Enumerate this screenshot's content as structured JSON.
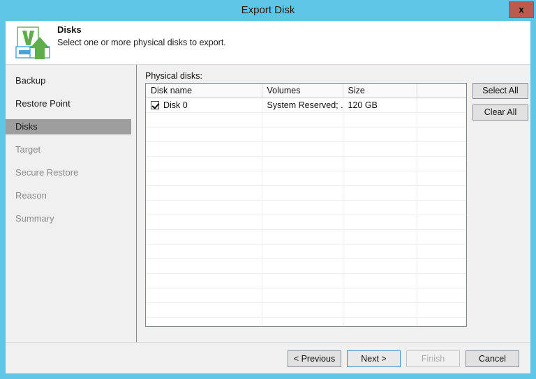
{
  "window": {
    "title": "Export Disk",
    "close_label": "x",
    "titlebar_color": "#5FC6E8",
    "close_color": "#BC5A50"
  },
  "header": {
    "title": "Disks",
    "subtitle": "Select one or more physical disks to export.",
    "icon": "veeam-export-disk-icon"
  },
  "sidebar": {
    "items": [
      {
        "label": "Backup",
        "state": "visited"
      },
      {
        "label": "Restore Point",
        "state": "visited"
      },
      {
        "label": "Disks",
        "state": "active"
      },
      {
        "label": "Target",
        "state": "pending"
      },
      {
        "label": "Secure Restore",
        "state": "pending"
      },
      {
        "label": "Reason",
        "state": "pending"
      },
      {
        "label": "Summary",
        "state": "pending"
      }
    ],
    "active_color": "#9E9E9E"
  },
  "main": {
    "list_label": "Physical disks:",
    "table": {
      "columns": [
        "Disk name",
        "Volumes",
        "Size",
        ""
      ],
      "rows": [
        {
          "checked": true,
          "disk_name": "Disk 0",
          "volumes": "System Reserved; ...",
          "size": "120 GB",
          "extra": ""
        }
      ],
      "empty_rows": 15
    },
    "buttons": {
      "select_all": "Select All",
      "clear_all": "Clear All"
    }
  },
  "footer": {
    "previous": "< Previous",
    "next": "Next >",
    "finish": "Finish",
    "cancel": "Cancel",
    "finish_enabled": false,
    "next_focused": true
  }
}
